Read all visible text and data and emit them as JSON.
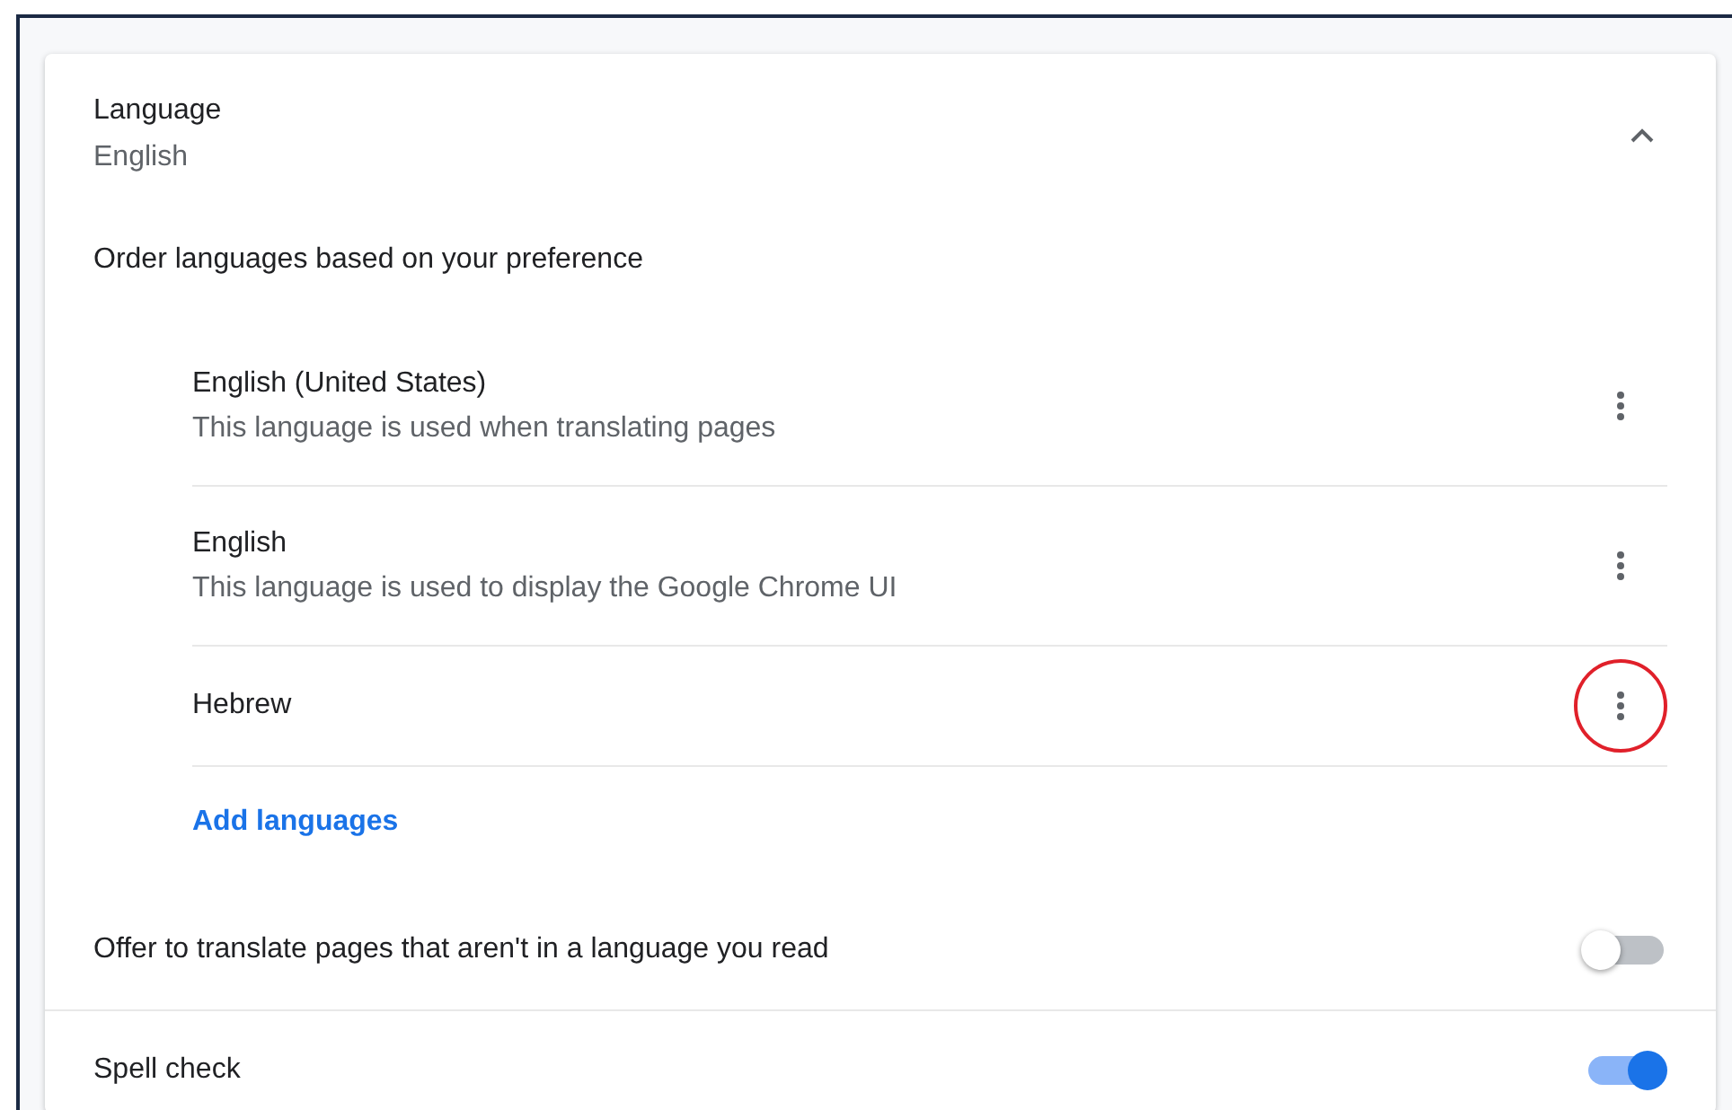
{
  "section": {
    "title": "Language",
    "subtitle": "English",
    "expanded": true
  },
  "order_heading": "Order languages based on your preference",
  "languages": [
    {
      "name": "English (United States)",
      "note": "This language is used when translating pages",
      "highlighted": false
    },
    {
      "name": "English",
      "note": "This language is used to display the Google Chrome UI",
      "highlighted": false
    },
    {
      "name": "Hebrew",
      "highlighted": true
    }
  ],
  "add_link": "Add languages",
  "settings": [
    {
      "label": "Offer to translate pages that aren't in a language you read",
      "on": false
    },
    {
      "label": "Spell check",
      "on": true
    }
  ]
}
